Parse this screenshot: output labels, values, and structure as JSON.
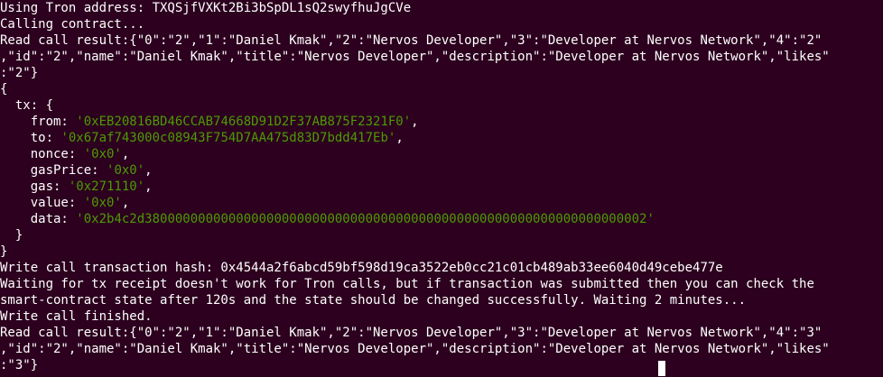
{
  "terminal": {
    "lines": [
      "Using Tron address: TXQSjfVXKt2Bi3bSpDL1sQ2swyfhuJgCVe",
      "Calling contract...",
      "Read call result:{\"0\":\"2\",\"1\":\"Daniel Kmak\",\"2\":\"Nervos Developer\",\"3\":\"Developer at Nervos Network\",\"4\":\"2\"",
      ",\"id\":\"2\",\"name\":\"Daniel Kmak\",\"title\":\"Nervos Developer\",\"description\":\"Developer at Nervos Network\",\"likes\"",
      ":\"2\"}",
      "{",
      "  tx: {"
    ],
    "tx_fields": [
      {
        "key": "    from: ",
        "value": "'0xEB20816BD46CCAB74668D91D2F37AB875F2321F0'",
        "suffix": ","
      },
      {
        "key": "    to: ",
        "value": "'0x67af743000c08943F754D7AA475d83D7bdd417Eb'",
        "suffix": ","
      },
      {
        "key": "    nonce: ",
        "value": "'0x0'",
        "suffix": ","
      },
      {
        "key": "    gasPrice: ",
        "value": "'0x0'",
        "suffix": ","
      },
      {
        "key": "    gas: ",
        "value": "'0x271110'",
        "suffix": ","
      },
      {
        "key": "    value: ",
        "value": "'0x0'",
        "suffix": ","
      },
      {
        "key": "    data: ",
        "value": "'0x2b4c2d380000000000000000000000000000000000000000000000000000000000000002'",
        "suffix": ""
      }
    ],
    "lines_after": [
      "  }",
      "}",
      "Write call transaction hash: 0x4544a2f6abcd59bf598d19ca3522eb0cc21c01cb489ab33ee6040d49cebe477e",
      "Waiting for tx receipt doesn't work for Tron calls, but if transaction was submitted then you can check the",
      "smart-contract state after 120s and the state should be changed successfully. Waiting 2 minutes...",
      "Write call finished.",
      "Read call result:{\"0\":\"2\",\"1\":\"Daniel Kmak\",\"2\":\"Nervos Developer\",\"3\":\"Developer at Nervos Network\",\"4\":\"3\"",
      ",\"id\":\"2\",\"name\":\"Daniel Kmak\",\"title\":\"Nervos Developer\",\"description\":\"Developer at Nervos Network\",\"likes\"",
      ":\"3\"}"
    ],
    "colors": {
      "background": "#2c001e",
      "text": "#ffffff",
      "string": "#4e9a06"
    }
  }
}
